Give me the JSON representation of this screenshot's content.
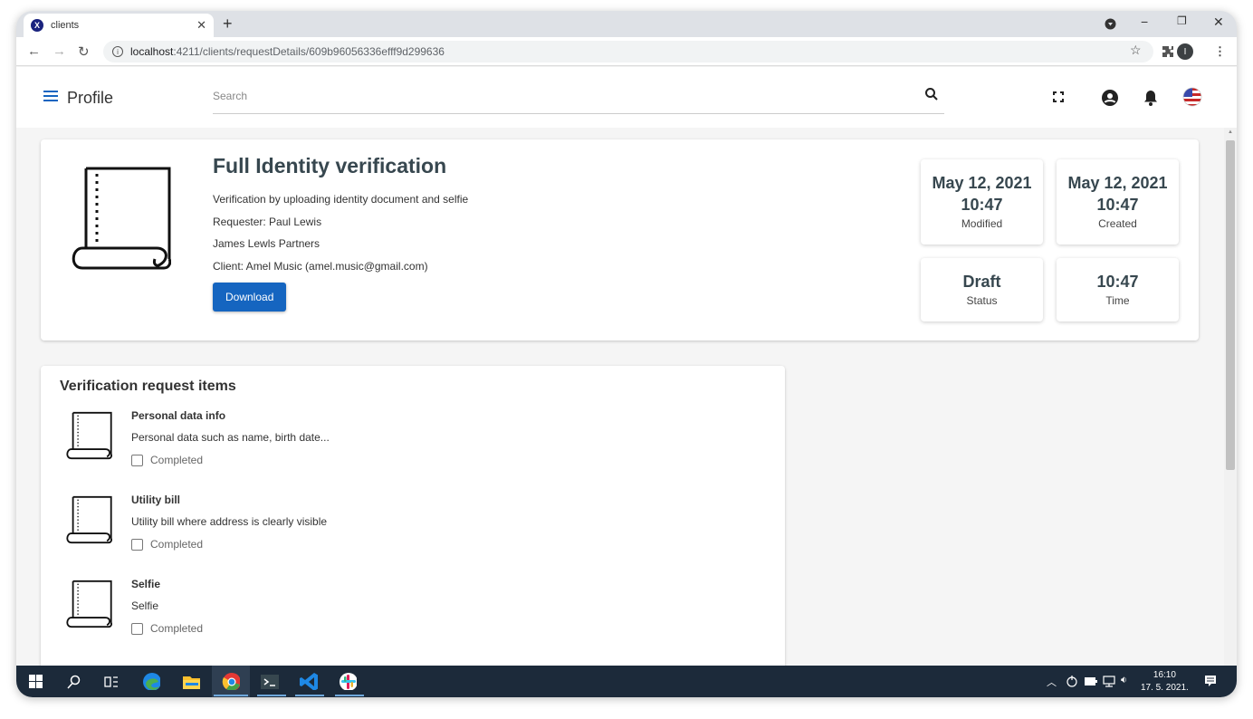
{
  "browser": {
    "tab_title": "clients",
    "tab_favicon_letter": "X",
    "url_host": "localhost",
    "url_path": ":4211/clients/requestDetails/609b96056336efff9d299636",
    "profile_initial": "I"
  },
  "header": {
    "title": "Profile",
    "search_placeholder": "Search"
  },
  "request": {
    "title": "Full Identity verification",
    "description": "Verification by uploading identity document and selfie",
    "requester": "Requester: Paul Lewis",
    "company": "James Lewls Partners",
    "client": "Client: Amel Music (amel.music@gmail.com)",
    "download_label": "Download"
  },
  "stats": [
    {
      "value": "May 12, 2021 10:47",
      "label": "Modified"
    },
    {
      "value": "May 12, 2021 10:47",
      "label": "Created"
    },
    {
      "value": "Draft",
      "label": "Status"
    },
    {
      "value": "10:47",
      "label": "Time"
    }
  ],
  "items_section": {
    "title": "Verification request items",
    "items": [
      {
        "name": "Personal data info",
        "description": "Personal data such as name, birth date...",
        "checkbox_label": "Completed",
        "completed": false
      },
      {
        "name": "Utility bill",
        "description": "Utility bill where address is clearly visible",
        "checkbox_label": "Completed",
        "completed": false
      },
      {
        "name": "Selfie",
        "description": "Selfie",
        "checkbox_label": "Completed",
        "completed": false
      }
    ]
  },
  "taskbar": {
    "time": "16:10",
    "date": "17. 5. 2021."
  },
  "colors": {
    "primary": "#1565c0",
    "taskbar": "#1c2a3a"
  }
}
